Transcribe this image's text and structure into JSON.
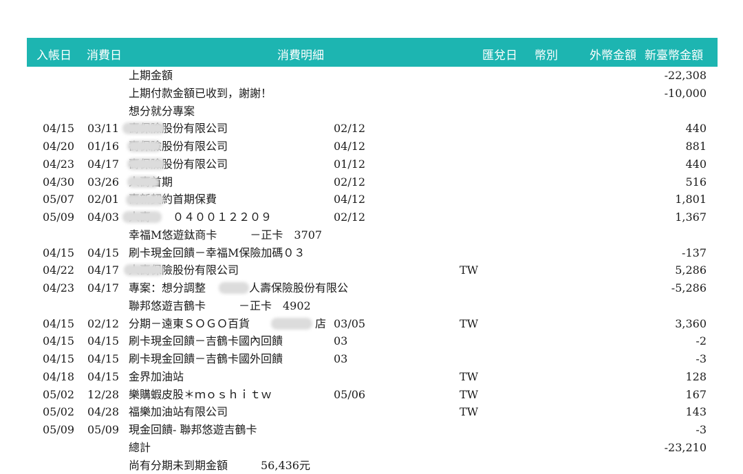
{
  "header": {
    "posting_date": "入帳日",
    "txn_date": "消費日",
    "description": "消費明細",
    "exchange_date": "匯兌日",
    "currency": "幣別",
    "foreign_amount": "外幣金額",
    "twd_amount": "新臺幣金額"
  },
  "rows": [
    {
      "post": "",
      "txn": "",
      "desc": "上期金額",
      "inst": "",
      "cur": "",
      "amt": "-22,308"
    },
    {
      "post": "",
      "txn": "",
      "desc": "上期付款金額已收到，謝謝！",
      "inst": "",
      "cur": "",
      "amt": "-10,000"
    },
    {
      "post": "",
      "txn": "",
      "desc": "想分就分專案",
      "inst": "",
      "cur": "",
      "amt": ""
    },
    {
      "post": "04/15",
      "txn": "03/11",
      "desc": "壽保險股份有限公司",
      "inst": "02/12",
      "cur": "",
      "amt": "440"
    },
    {
      "post": "04/20",
      "txn": "01/16",
      "desc": "壽保險股份有限公司",
      "inst": "04/12",
      "cur": "",
      "amt": "881"
    },
    {
      "post": "04/23",
      "txn": "04/17",
      "desc": "壽保險股份有限公司",
      "inst": "01/12",
      "cur": "",
      "amt": "440"
    },
    {
      "post": "04/30",
      "txn": "03/26",
      "desc": "人壽首期",
      "inst": "02/12",
      "cur": "",
      "amt": "516"
    },
    {
      "post": "05/07",
      "txn": "02/01",
      "desc": "壽新契約首期保費",
      "inst": "04/12",
      "cur": "",
      "amt": "1,801"
    },
    {
      "post": "05/09",
      "txn": "04/03",
      "desc": "人壽　　０４００１２２０９",
      "inst": "02/12",
      "cur": "",
      "amt": "1,367"
    },
    {
      "post": "",
      "txn": "",
      "desc": "幸福M悠遊鈦商卡　　　－正卡　3707",
      "inst": "",
      "cur": "",
      "amt": ""
    },
    {
      "post": "04/15",
      "txn": "04/15",
      "desc": "刷卡現金回饋－幸福M保險加碼０３",
      "inst": "",
      "cur": "",
      "amt": "-137"
    },
    {
      "post": "04/22",
      "txn": "04/17",
      "desc": "人壽保險股份有限公司",
      "inst": "",
      "cur": "TW",
      "amt": "5,286"
    },
    {
      "post": "04/23",
      "txn": "04/17",
      "desc": "專案：想分調整",
      "desc2": "人壽保險股份有限公",
      "inst": "",
      "cur": "",
      "amt": "-5,286"
    },
    {
      "post": "",
      "txn": "",
      "desc": "聯邦悠遊吉鶴卡　　　－正卡　4902",
      "inst": "",
      "cur": "",
      "amt": ""
    },
    {
      "post": "04/15",
      "txn": "02/12",
      "desc": "分期－遠東ＳＯＧＯ百貨",
      "desc2": "店",
      "inst": "03/05",
      "cur": "TW",
      "amt": "3,360"
    },
    {
      "post": "04/15",
      "txn": "04/15",
      "desc": "刷卡現金回饋－吉鶴卡國內回饋",
      "inst": "03",
      "cur": "",
      "amt": "-2"
    },
    {
      "post": "04/15",
      "txn": "04/15",
      "desc": "刷卡現金回饋－吉鶴卡國外回饋",
      "inst": "03",
      "cur": "",
      "amt": "-3"
    },
    {
      "post": "04/18",
      "txn": "04/15",
      "desc": "金界加油站",
      "inst": "",
      "cur": "TW",
      "amt": "128"
    },
    {
      "post": "05/02",
      "txn": "12/28",
      "desc": "樂購蝦皮股＊ｍｏｓｈｉｔｗ",
      "inst": "05/06",
      "cur": "TW",
      "amt": "167"
    },
    {
      "post": "05/02",
      "txn": "04/28",
      "desc": "福樂加油站有限公司",
      "inst": "",
      "cur": "TW",
      "amt": "143"
    },
    {
      "post": "05/09",
      "txn": "05/09",
      "desc": "現金回饋- 聯邦悠遊吉鶴卡",
      "inst": "",
      "cur": "",
      "amt": "-3"
    },
    {
      "post": "",
      "txn": "",
      "desc": "總計",
      "inst": "",
      "cur": "",
      "amt": "-23,210"
    },
    {
      "post": "",
      "txn": "",
      "desc": "尚有分期未到期金額　　　56,436元",
      "inst": "",
      "cur": "",
      "amt": ""
    }
  ]
}
